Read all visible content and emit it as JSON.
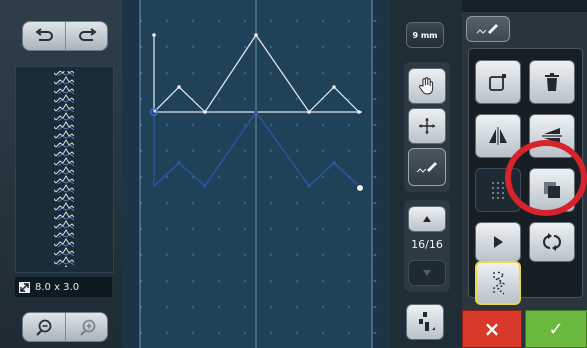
{
  "toolbar": {
    "undo_icon": "undo-arrow-icon",
    "redo_icon": "redo-arrow-icon",
    "zoom_out_icon": "zoom-out-icon",
    "zoom_in_icon": "zoom-in-icon"
  },
  "preview": {
    "size_label": "8.0 x 3.0"
  },
  "right_column": {
    "width_button": "9 mm",
    "counter": "16/16"
  },
  "tools_panel": {
    "tab_icon": "stitch-edit-icon",
    "items": [
      {
        "icon": "new-point-icon"
      },
      {
        "icon": "trash-icon"
      },
      {
        "icon": "mirror-horizontal-icon"
      },
      {
        "icon": "mirror-vertical-icon"
      },
      {
        "icon": "dotted-grid-icon"
      },
      {
        "icon": "copy-layer-icon"
      },
      {
        "icon": "play-icon"
      },
      {
        "icon": "repeat-cycle-icon"
      },
      {
        "icon": "zigzag-select-icon"
      }
    ]
  },
  "footer": {
    "cancel_symbol": "×",
    "confirm_symbol": "✓"
  },
  "colors": {
    "cancel": "#d8392b",
    "confirm": "#6ab83d",
    "highlight_ring": "#d7232a",
    "selected_border": "#e8d84a",
    "stitch_upper": "#e8eef2",
    "stitch_lower": "#2c57a8"
  }
}
